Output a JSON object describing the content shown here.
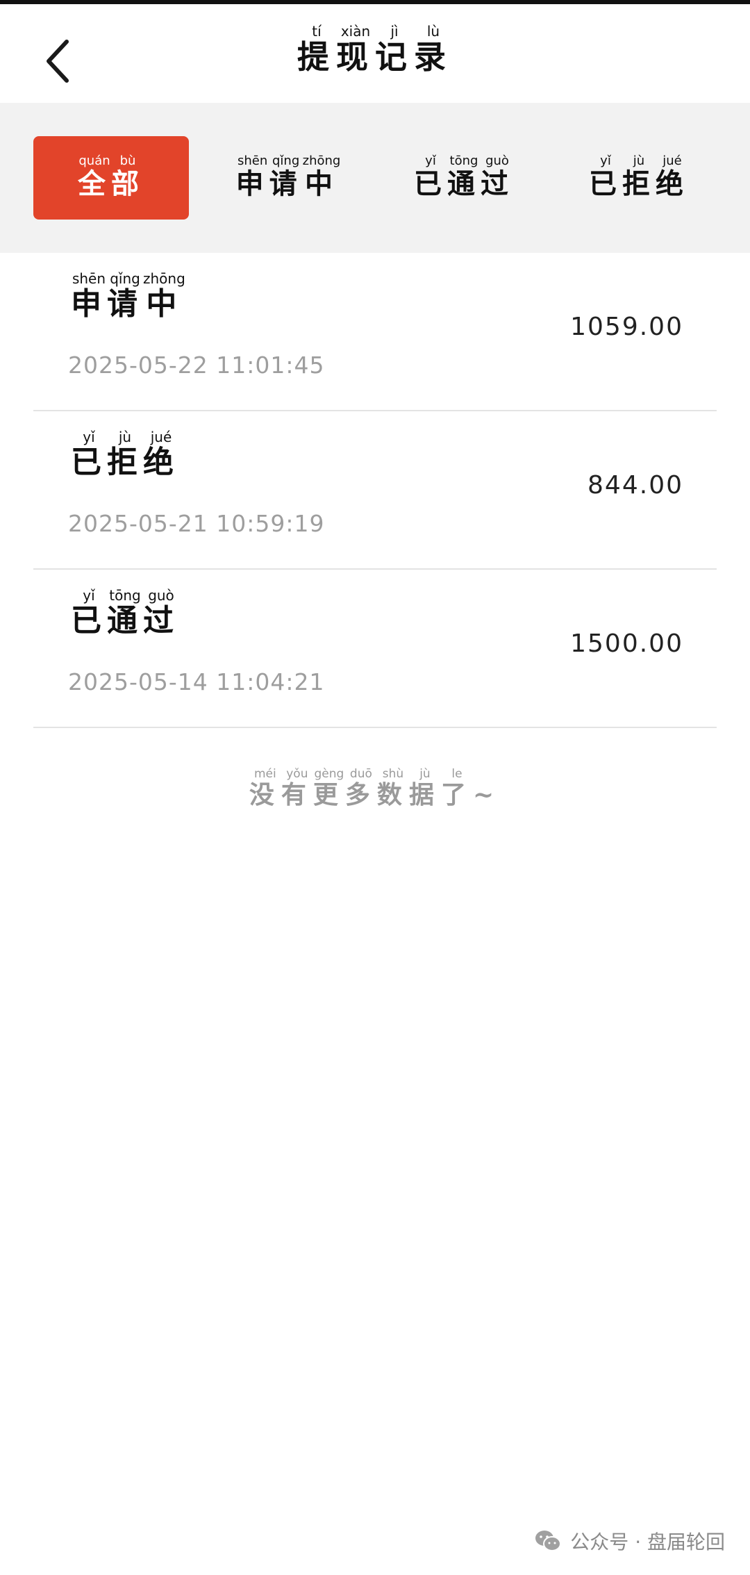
{
  "header": {
    "title": [
      {
        "char": "提",
        "pinyin": "tí"
      },
      {
        "char": "现",
        "pinyin": "xiàn"
      },
      {
        "char": "记",
        "pinyin": "jì"
      },
      {
        "char": "录",
        "pinyin": "lù"
      }
    ]
  },
  "tabs": [
    {
      "active": true,
      "chars": [
        {
          "char": "全",
          "pinyin": "quán"
        },
        {
          "char": "部",
          "pinyin": "bù"
        }
      ]
    },
    {
      "active": false,
      "chars": [
        {
          "char": "申",
          "pinyin": "shēn"
        },
        {
          "char": "请",
          "pinyin": "qǐng"
        },
        {
          "char": "中",
          "pinyin": "zhōng"
        }
      ]
    },
    {
      "active": false,
      "chars": [
        {
          "char": "已",
          "pinyin": "yǐ"
        },
        {
          "char": "通",
          "pinyin": "tōng"
        },
        {
          "char": "过",
          "pinyin": "guò"
        }
      ]
    },
    {
      "active": false,
      "chars": [
        {
          "char": "已",
          "pinyin": "yǐ"
        },
        {
          "char": "拒",
          "pinyin": "jù"
        },
        {
          "char": "绝",
          "pinyin": "jué"
        }
      ]
    }
  ],
  "records": [
    {
      "status": [
        {
          "char": "申",
          "pinyin": "shēn"
        },
        {
          "char": "请",
          "pinyin": "qǐng"
        },
        {
          "char": "中",
          "pinyin": "zhōng"
        }
      ],
      "time": "2025-05-22 11:01:45",
      "amount": "1059.00"
    },
    {
      "status": [
        {
          "char": "已",
          "pinyin": "yǐ"
        },
        {
          "char": "拒",
          "pinyin": "jù"
        },
        {
          "char": "绝",
          "pinyin": "jué"
        }
      ],
      "time": "2025-05-21 10:59:19",
      "amount": "844.00"
    },
    {
      "status": [
        {
          "char": "已",
          "pinyin": "yǐ"
        },
        {
          "char": "通",
          "pinyin": "tōng"
        },
        {
          "char": "过",
          "pinyin": "guò"
        }
      ],
      "time": "2025-05-14 11:04:21",
      "amount": "1500.00"
    }
  ],
  "end_note": {
    "chars": [
      {
        "char": "没",
        "pinyin": "méi"
      },
      {
        "char": "有",
        "pinyin": "yǒu"
      },
      {
        "char": "更",
        "pinyin": "gèng"
      },
      {
        "char": "多",
        "pinyin": "duō"
      },
      {
        "char": "数",
        "pinyin": "shù"
      },
      {
        "char": "据",
        "pinyin": "jù"
      },
      {
        "char": "了",
        "pinyin": "le"
      }
    ],
    "suffix": "~"
  },
  "watermark": {
    "text": "公众号 · 盘届轮回",
    "icon": "wechat-icon"
  },
  "colors": {
    "accent": "#e2442a",
    "tab_bar_bg": "#f2f2f2",
    "muted_text": "#9e9e9e",
    "divider": "#e3e3e3"
  }
}
